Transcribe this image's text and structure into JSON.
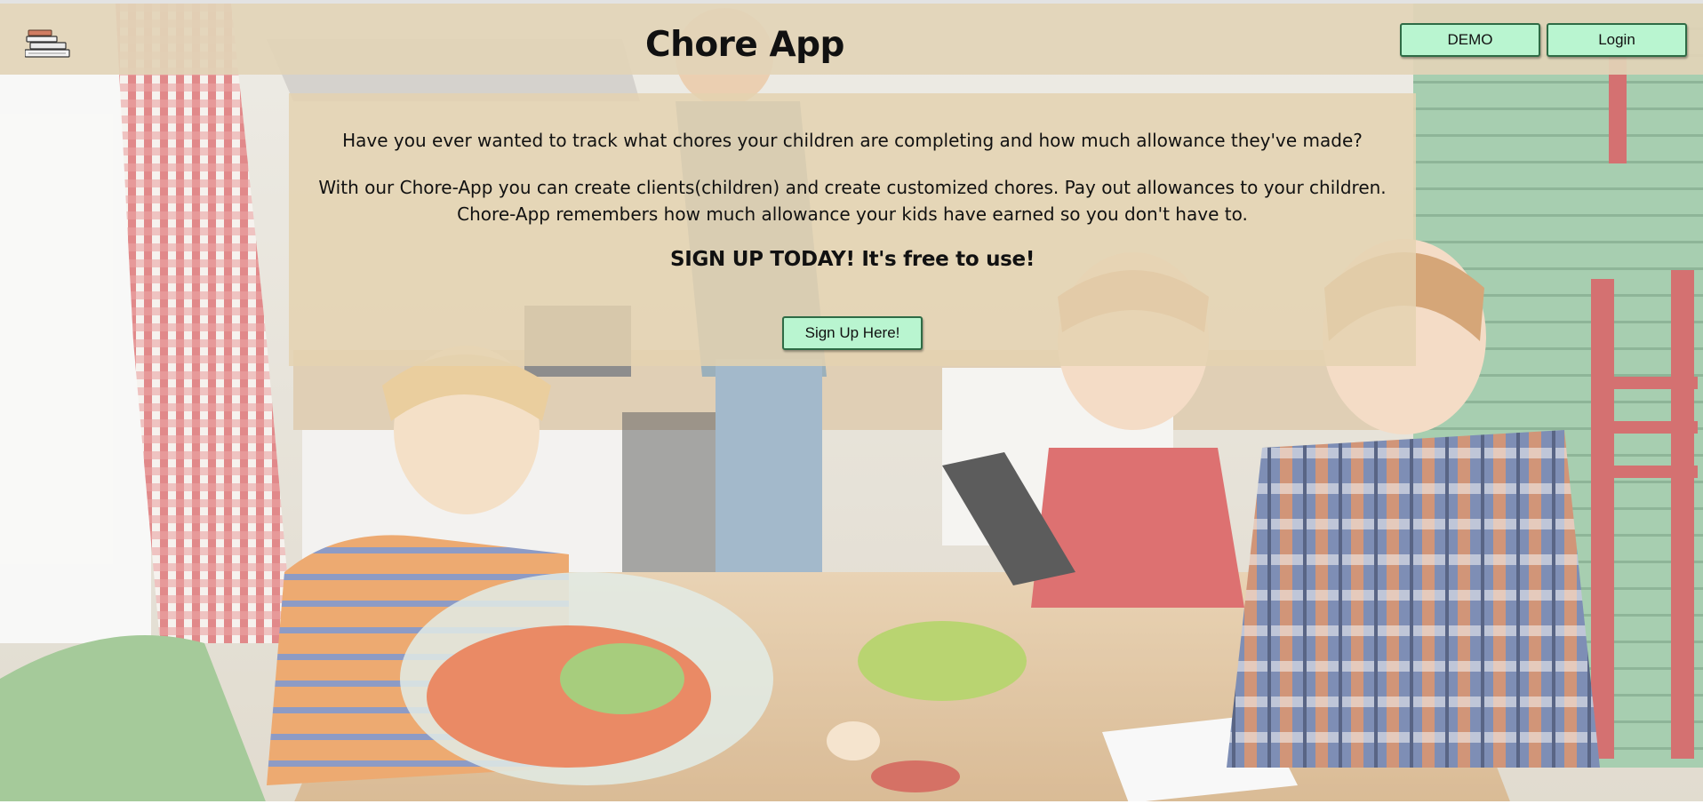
{
  "header": {
    "logo_icon": "books-stack-icon",
    "title": "Chore App",
    "demo_label": "DEMO",
    "login_label": "Login"
  },
  "intro": {
    "question": "Have you ever wanted to track what chores your children are completing and how much allowance they've made?",
    "description_line1": "With our Chore-App you can create clients(children) and create customized chores. Pay out allowances to your children.",
    "description_line2": "Chore-App remembers how much allowance your kids have earned so you don't have to.",
    "call_to_action": "SIGN UP TODAY! It's free to use!",
    "signup_label": "Sign Up Here!"
  },
  "colors": {
    "button_bg": "#b9f5d0",
    "button_border": "#2e6b45",
    "header_bg": "#e2d4b7",
    "panel_bg": "#e4d2b0"
  }
}
